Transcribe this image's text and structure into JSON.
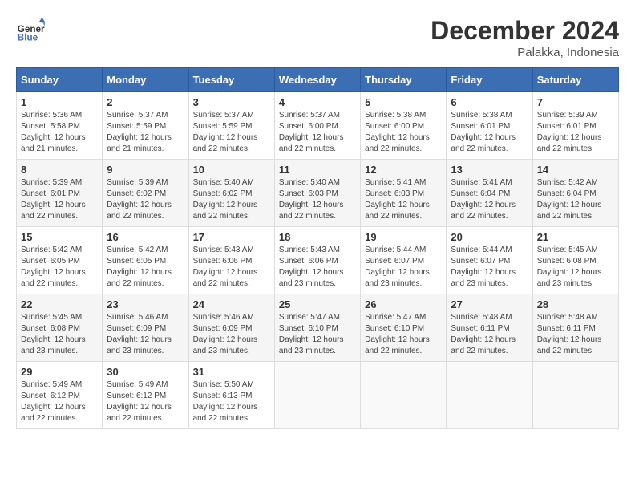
{
  "logo": {
    "line1": "General",
    "line2": "Blue"
  },
  "title": "December 2024",
  "location": "Palakka, Indonesia",
  "days_header": [
    "Sunday",
    "Monday",
    "Tuesday",
    "Wednesday",
    "Thursday",
    "Friday",
    "Saturday"
  ],
  "weeks": [
    [
      {
        "day": "1",
        "sunrise": "5:36 AM",
        "sunset": "5:58 PM",
        "daylight": "12 hours and 21 minutes."
      },
      {
        "day": "2",
        "sunrise": "5:37 AM",
        "sunset": "5:59 PM",
        "daylight": "12 hours and 21 minutes."
      },
      {
        "day": "3",
        "sunrise": "5:37 AM",
        "sunset": "5:59 PM",
        "daylight": "12 hours and 22 minutes."
      },
      {
        "day": "4",
        "sunrise": "5:37 AM",
        "sunset": "6:00 PM",
        "daylight": "12 hours and 22 minutes."
      },
      {
        "day": "5",
        "sunrise": "5:38 AM",
        "sunset": "6:00 PM",
        "daylight": "12 hours and 22 minutes."
      },
      {
        "day": "6",
        "sunrise": "5:38 AM",
        "sunset": "6:01 PM",
        "daylight": "12 hours and 22 minutes."
      },
      {
        "day": "7",
        "sunrise": "5:39 AM",
        "sunset": "6:01 PM",
        "daylight": "12 hours and 22 minutes."
      }
    ],
    [
      {
        "day": "8",
        "sunrise": "5:39 AM",
        "sunset": "6:01 PM",
        "daylight": "12 hours and 22 minutes."
      },
      {
        "day": "9",
        "sunrise": "5:39 AM",
        "sunset": "6:02 PM",
        "daylight": "12 hours and 22 minutes."
      },
      {
        "day": "10",
        "sunrise": "5:40 AM",
        "sunset": "6:02 PM",
        "daylight": "12 hours and 22 minutes."
      },
      {
        "day": "11",
        "sunrise": "5:40 AM",
        "sunset": "6:03 PM",
        "daylight": "12 hours and 22 minutes."
      },
      {
        "day": "12",
        "sunrise": "5:41 AM",
        "sunset": "6:03 PM",
        "daylight": "12 hours and 22 minutes."
      },
      {
        "day": "13",
        "sunrise": "5:41 AM",
        "sunset": "6:04 PM",
        "daylight": "12 hours and 22 minutes."
      },
      {
        "day": "14",
        "sunrise": "5:42 AM",
        "sunset": "6:04 PM",
        "daylight": "12 hours and 22 minutes."
      }
    ],
    [
      {
        "day": "15",
        "sunrise": "5:42 AM",
        "sunset": "6:05 PM",
        "daylight": "12 hours and 22 minutes."
      },
      {
        "day": "16",
        "sunrise": "5:42 AM",
        "sunset": "6:05 PM",
        "daylight": "12 hours and 22 minutes."
      },
      {
        "day": "17",
        "sunrise": "5:43 AM",
        "sunset": "6:06 PM",
        "daylight": "12 hours and 22 minutes."
      },
      {
        "day": "18",
        "sunrise": "5:43 AM",
        "sunset": "6:06 PM",
        "daylight": "12 hours and 23 minutes."
      },
      {
        "day": "19",
        "sunrise": "5:44 AM",
        "sunset": "6:07 PM",
        "daylight": "12 hours and 23 minutes."
      },
      {
        "day": "20",
        "sunrise": "5:44 AM",
        "sunset": "6:07 PM",
        "daylight": "12 hours and 23 minutes."
      },
      {
        "day": "21",
        "sunrise": "5:45 AM",
        "sunset": "6:08 PM",
        "daylight": "12 hours and 23 minutes."
      }
    ],
    [
      {
        "day": "22",
        "sunrise": "5:45 AM",
        "sunset": "6:08 PM",
        "daylight": "12 hours and 23 minutes."
      },
      {
        "day": "23",
        "sunrise": "5:46 AM",
        "sunset": "6:09 PM",
        "daylight": "12 hours and 23 minutes."
      },
      {
        "day": "24",
        "sunrise": "5:46 AM",
        "sunset": "6:09 PM",
        "daylight": "12 hours and 23 minutes."
      },
      {
        "day": "25",
        "sunrise": "5:47 AM",
        "sunset": "6:10 PM",
        "daylight": "12 hours and 23 minutes."
      },
      {
        "day": "26",
        "sunrise": "5:47 AM",
        "sunset": "6:10 PM",
        "daylight": "12 hours and 22 minutes."
      },
      {
        "day": "27",
        "sunrise": "5:48 AM",
        "sunset": "6:11 PM",
        "daylight": "12 hours and 22 minutes."
      },
      {
        "day": "28",
        "sunrise": "5:48 AM",
        "sunset": "6:11 PM",
        "daylight": "12 hours and 22 minutes."
      }
    ],
    [
      {
        "day": "29",
        "sunrise": "5:49 AM",
        "sunset": "6:12 PM",
        "daylight": "12 hours and 22 minutes."
      },
      {
        "day": "30",
        "sunrise": "5:49 AM",
        "sunset": "6:12 PM",
        "daylight": "12 hours and 22 minutes."
      },
      {
        "day": "31",
        "sunrise": "5:50 AM",
        "sunset": "6:13 PM",
        "daylight": "12 hours and 22 minutes."
      },
      null,
      null,
      null,
      null
    ]
  ]
}
